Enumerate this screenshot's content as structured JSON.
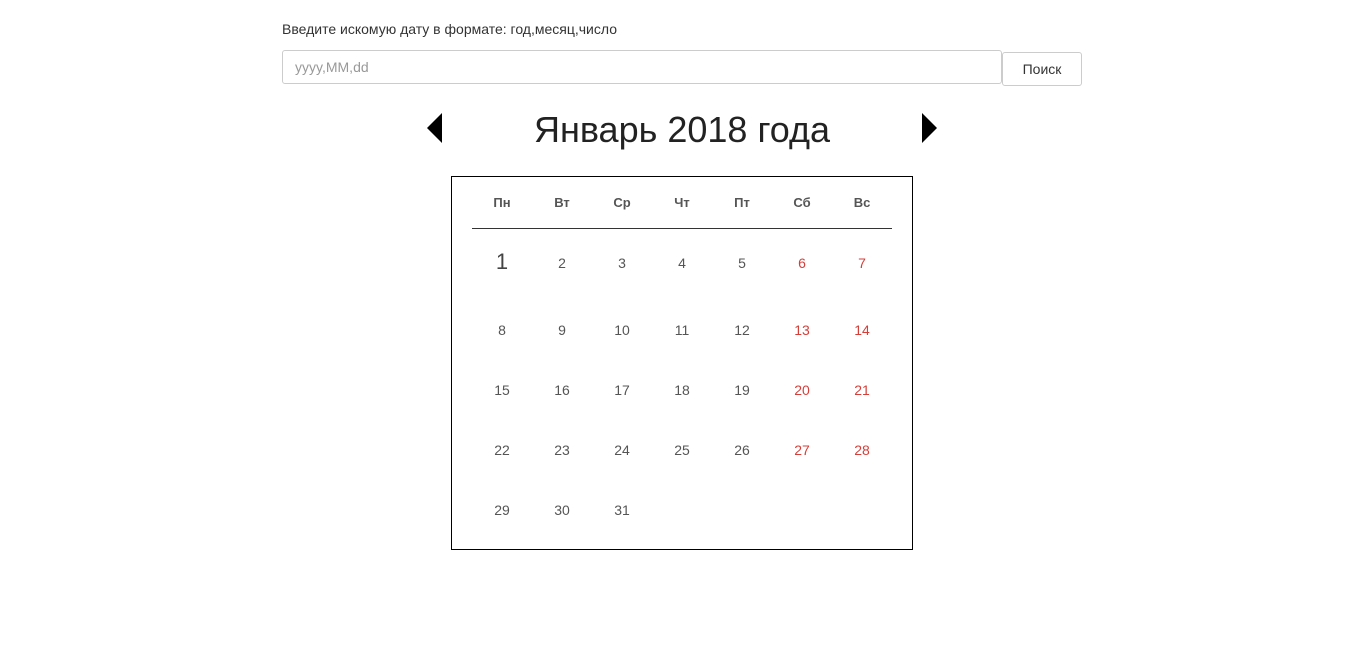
{
  "search": {
    "label": "Введите искомую дату в формате: год,месяц,число",
    "placeholder": "yyyy,MM,dd",
    "value": "",
    "button_label": "Поиск"
  },
  "calendar": {
    "title": "Январь 2018 года",
    "weekdays": [
      "Пн",
      "Вт",
      "Ср",
      "Чт",
      "Пт",
      "Сб",
      "Вс"
    ],
    "weeks": [
      [
        "1",
        "2",
        "3",
        "4",
        "5",
        "6",
        "7"
      ],
      [
        "8",
        "9",
        "10",
        "11",
        "12",
        "13",
        "14"
      ],
      [
        "15",
        "16",
        "17",
        "18",
        "19",
        "20",
        "21"
      ],
      [
        "22",
        "23",
        "24",
        "25",
        "26",
        "27",
        "28"
      ],
      [
        "29",
        "30",
        "31",
        "",
        "",
        "",
        ""
      ]
    ],
    "highlighted_day": "1",
    "weekend_color": "#d43f3a"
  }
}
